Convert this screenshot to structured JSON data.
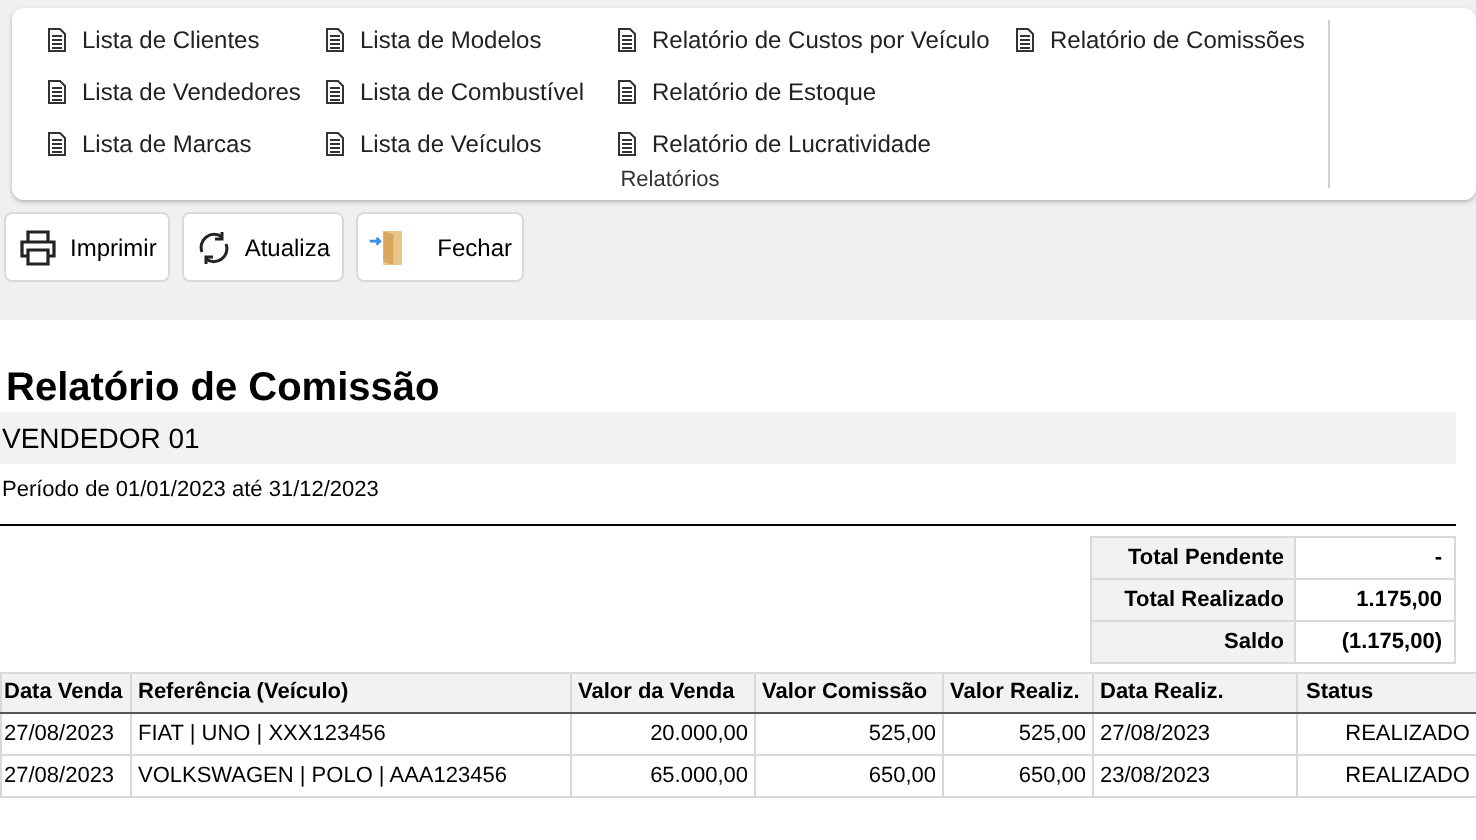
{
  "ribbon": {
    "group_label": "Relatórios",
    "columns": [
      [
        "Lista de Clientes",
        "Lista de Vendedores",
        "Lista de Marcas"
      ],
      [
        "Lista de Modelos",
        "Lista de Combustível",
        "Lista de Veículos"
      ],
      [
        "Relatório de Custos por Veículo",
        "Relatório de Estoque",
        "Relatório de Lucratividade"
      ],
      [
        "Relatório de Comissões"
      ]
    ]
  },
  "toolbar": [
    {
      "kind": "print",
      "label": "Imprimir"
    },
    {
      "kind": "refresh",
      "label": "Atualiza"
    },
    {
      "kind": "exit",
      "label": "Fechar"
    }
  ],
  "report": {
    "title": "Relatório de Comissão",
    "seller": "VENDEDOR 01",
    "period": "Período de 01/01/2023 até 31/12/2023",
    "summary": [
      {
        "label": "Total Pendente",
        "value": "-"
      },
      {
        "label": "Total Realizado",
        "value": "1.175,00"
      },
      {
        "label": "Saldo",
        "value": "(1.175,00)"
      }
    ],
    "table": {
      "columns": [
        "Data Venda",
        "Referência (Veículo)",
        "Valor da Venda",
        "Valor Comissão",
        "Valor Realiz.",
        "Data Realiz.",
        "Status"
      ],
      "rows": [
        [
          "27/08/2023",
          "FIAT | UNO | XXX123456",
          "20.000,00",
          "525,00",
          "525,00",
          "27/08/2023",
          "REALIZADO"
        ],
        [
          "27/08/2023",
          "VOLKSWAGEN | POLO | AAA123456",
          "65.000,00",
          "650,00",
          "650,00",
          "23/08/2023",
          "REALIZADO"
        ]
      ]
    }
  }
}
